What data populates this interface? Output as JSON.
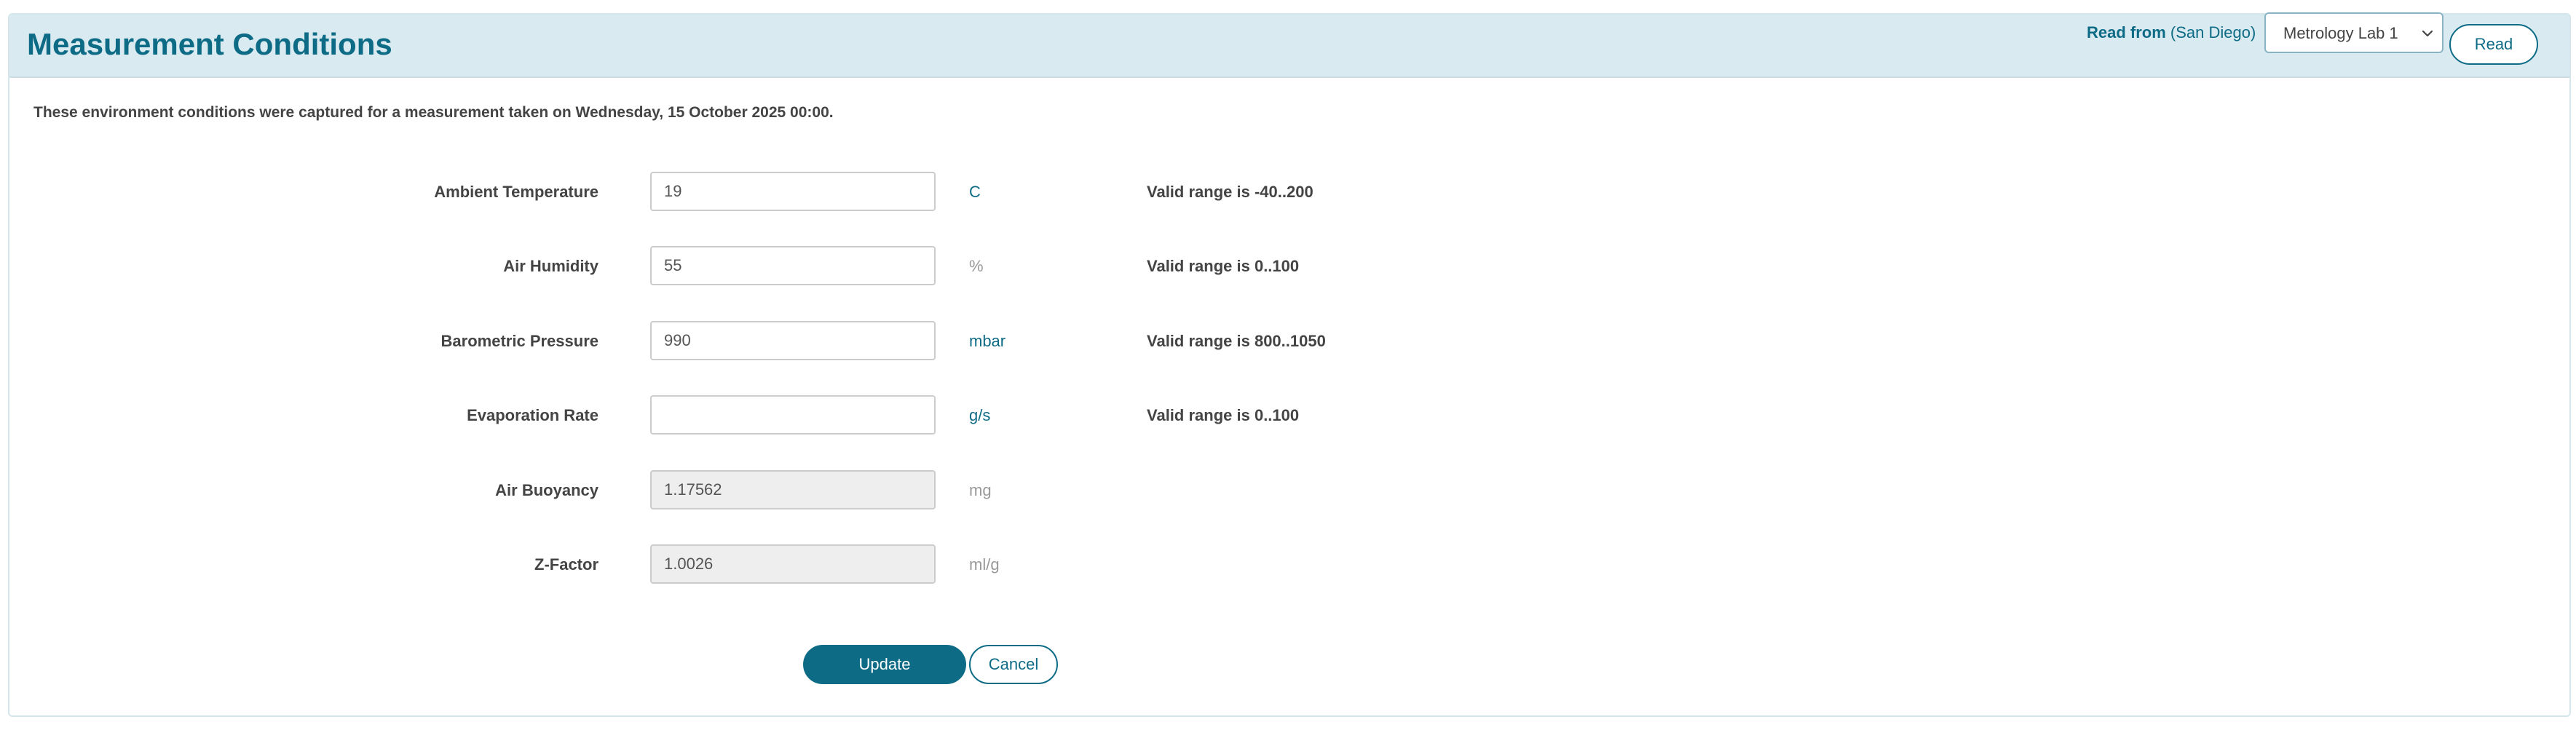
{
  "header": {
    "title": "Measurement Conditions",
    "read_from_label": "Read from",
    "read_from_location": "(San Diego)",
    "device_select_value": "Metrology Lab 1",
    "read_button": "Read"
  },
  "intro_text": "These environment conditions were captured for a measurement taken on Wednesday, 15 October 2025 00:00.",
  "fields": [
    {
      "label": "Ambient Temperature",
      "value": "19",
      "placeholder": "",
      "unit": "C",
      "range": "Valid range is -40..200",
      "readonly": false
    },
    {
      "label": "Air Humidity",
      "value": "55",
      "placeholder": "",
      "unit": "%",
      "range": "Valid range is 0..100",
      "readonly": false
    },
    {
      "label": "Barometric Pressure",
      "value": "990",
      "placeholder": "",
      "unit": "mbar",
      "range": "Valid range is 800..1050",
      "readonly": false
    },
    {
      "label": "Evaporation Rate",
      "value": "",
      "placeholder": "",
      "unit": "g/s",
      "range": "Valid range is 0..100",
      "readonly": false
    },
    {
      "label": "Air Buoyancy",
      "value": "1.17562",
      "placeholder": "",
      "unit": "mg",
      "range": "",
      "readonly": true
    },
    {
      "label": "Z-Factor",
      "value": "1.0026",
      "placeholder": "",
      "unit": "ml/g",
      "range": "",
      "readonly": true
    }
  ],
  "actions": {
    "update_label": "Update",
    "cancel_label": "Cancel"
  },
  "colors": {
    "accent": "#0e6b86",
    "header_background": "#d9ebf1",
    "muted_unit": "#999999",
    "readonly_background": "#eeeeee"
  },
  "icons": {
    "select_chevron": "chevron-down-icon"
  }
}
